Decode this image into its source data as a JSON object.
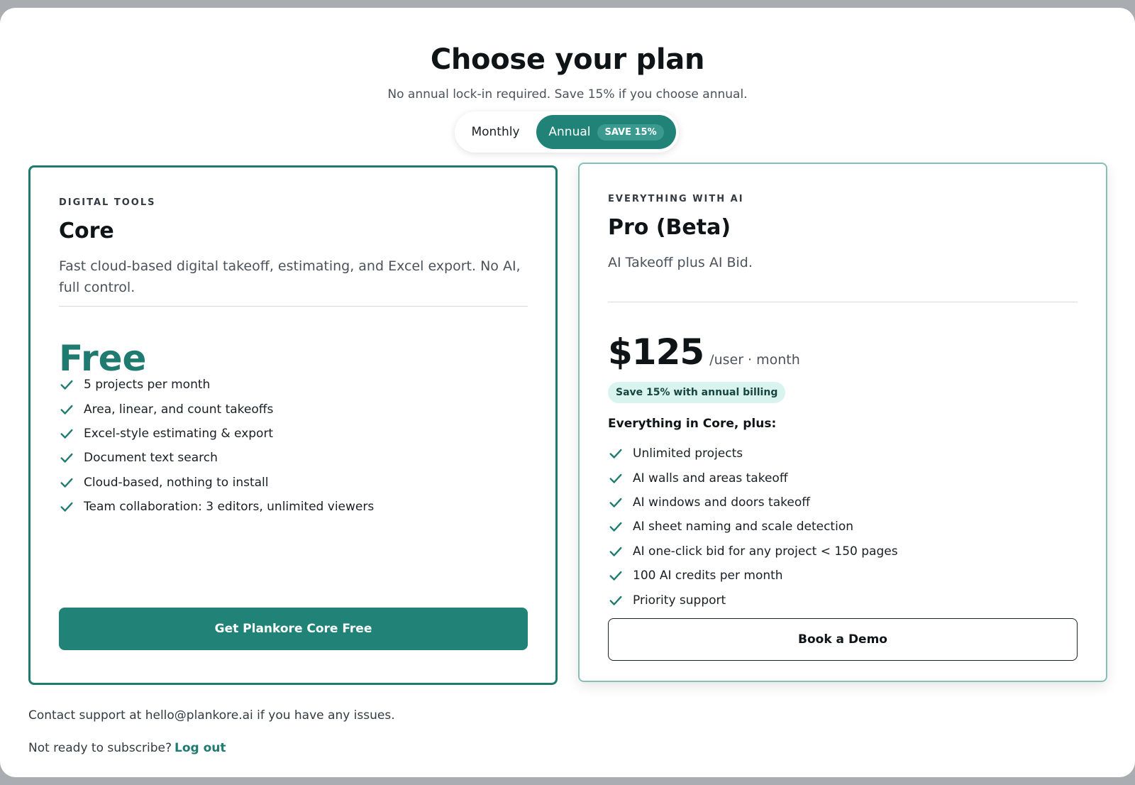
{
  "header": {
    "title": "Choose your plan",
    "subtitle": "No annual lock-in required. Save 15% if you choose annual."
  },
  "billing_toggle": {
    "monthly_label": "Monthly",
    "annual_label": "Annual",
    "save_badge": "SAVE 15%",
    "selected": "Annual"
  },
  "plans": [
    {
      "eyebrow": "DIGITAL TOOLS",
      "name": "Core",
      "description": "Fast cloud-based digital takeoff, estimating, and Excel export. No AI, full control.",
      "price": "Free",
      "features": [
        "5 projects per month",
        "Area, linear, and count takeoffs",
        "Excel-style estimating & export",
        "Document text search",
        "Cloud-based, nothing to install",
        "Team collaboration: 3 editors, unlimited viewers"
      ],
      "cta": "Get Plankore Core Free"
    },
    {
      "eyebrow": "EVERYTHING WITH AI",
      "name": "Pro (Beta)",
      "description": "AI Takeoff plus AI Bid.",
      "price": "$125",
      "price_unit": "/user · month",
      "annual_badge": "Save 15% with annual billing",
      "includes_heading": "Everything in Core, plus:",
      "features": [
        "Unlimited projects",
        "AI walls and areas takeoff",
        "AI windows and doors takeoff",
        "AI sheet naming and scale detection",
        "AI one-click bid for any project < 150 pages",
        "100 AI credits per month",
        "Priority support"
      ],
      "cta": "Book a Demo"
    }
  ],
  "footer": {
    "contact": "Contact support at hello@plankore.ai if you have any issues.",
    "not_ready": "Not ready to subscribe?",
    "logout": "Log out"
  },
  "colors": {
    "accent": "#218377",
    "accent_dark": "#1f7a70",
    "badge_bg": "#d9f4ef",
    "backdrop": "#a9acb1"
  },
  "icons": {
    "feature_check": "check-icon"
  }
}
